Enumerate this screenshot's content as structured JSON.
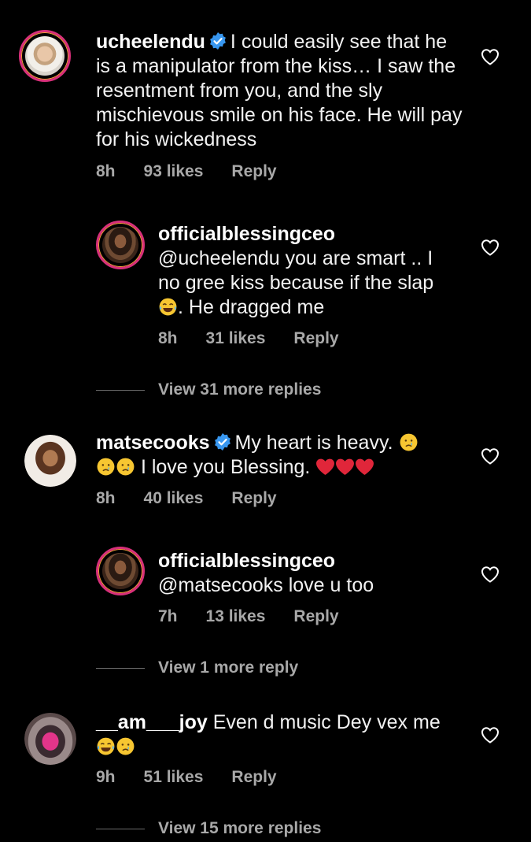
{
  "comments": [
    {
      "username": "ucheelendu",
      "verified": true,
      "text": "I could easily see that he is a manipulator from the kiss… I saw the resentment from you, and the sly mischievous smile on his face. He will pay for his wickedness",
      "time": "8h",
      "likes": "93 likes",
      "reply": "Reply",
      "replies": [
        {
          "username": "officialblessingceo",
          "text_line1": "@ucheelendu you are smart .. I",
          "text_line2": "no gree kiss because if the slap",
          "text_line3": ". He dragged me",
          "time": "8h",
          "likes": "31 likes",
          "reply": "Reply"
        }
      ],
      "view_more": "View 31 more replies"
    },
    {
      "username": "matsecooks",
      "verified": true,
      "text_line1": "My heart is heavy.",
      "text_line2": "I love you Blessing.",
      "time": "8h",
      "likes": "40 likes",
      "reply": "Reply",
      "replies": [
        {
          "username": "officialblessingceo",
          "text": "@matsecooks love u too",
          "time": "7h",
          "likes": "13 likes",
          "reply": "Reply"
        }
      ],
      "view_more": "View 1 more reply"
    },
    {
      "username": "__am___joy",
      "verified": false,
      "text": "Even d music Dey vex me",
      "time": "9h",
      "likes": "51 likes",
      "reply": "Reply",
      "view_more": "View 15 more replies"
    }
  ],
  "colors": {
    "background": "#000000",
    "text": "#f2f2f2",
    "meta": "#a8a8a8",
    "verified": "#3897f0",
    "heart_emoji": "#e0263a",
    "story_ring": "#d8307a"
  },
  "icons": {
    "like": "heart-outline-icon",
    "verified": "verified-badge-icon"
  }
}
